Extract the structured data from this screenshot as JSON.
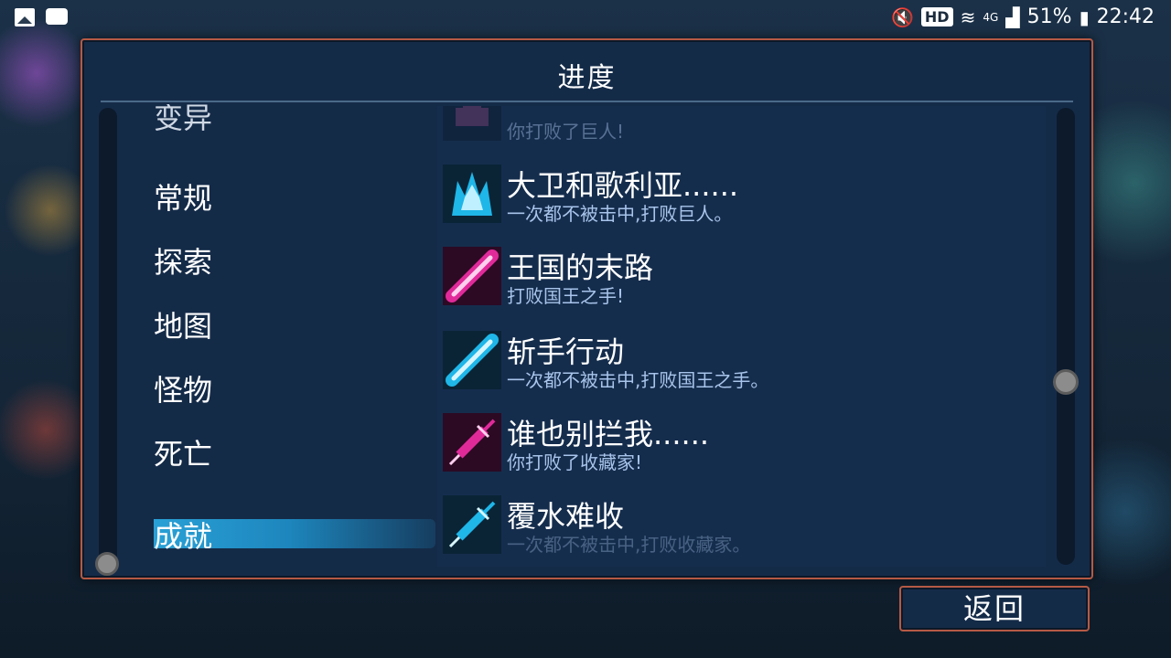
{
  "status_bar": {
    "left_icons": [
      "image-icon",
      "message-icon"
    ],
    "hd_label": "HD",
    "network": "4G",
    "battery": "51%",
    "time": "22:42"
  },
  "panel": {
    "title": "进度"
  },
  "menu": {
    "items": [
      {
        "label": "变异",
        "state": "partially-visible"
      },
      {
        "label": "常规"
      },
      {
        "label": "探索"
      },
      {
        "label": "地图"
      },
      {
        "label": "怪物"
      },
      {
        "label": "死亡"
      },
      {
        "label": "成就",
        "state": "selected"
      }
    ]
  },
  "achievements": [
    {
      "title": "",
      "desc": "你打败了巨人!",
      "icon": "giant-icon",
      "state": "partially-visible"
    },
    {
      "title": "大卫和歌利亚......",
      "desc": "一次都不被击中,打败巨人。",
      "icon": "giant-crown-icon",
      "icon_color": "#1fb6e8"
    },
    {
      "title": "王国的末路",
      "desc": "打败国王之手!",
      "icon": "blade-icon",
      "icon_color": "#e02a9a"
    },
    {
      "title": "斩手行动",
      "desc": "一次都不被击中,打败国王之手。",
      "icon": "blade-icon",
      "icon_color": "#1fb6e8"
    },
    {
      "title": "谁也别拦我......",
      "desc": "你打败了收藏家!",
      "icon": "syringe-icon",
      "icon_color": "#e02a9a"
    },
    {
      "title": "覆水难收",
      "desc": "一次都不被击中,打败收藏家。",
      "icon": "syringe-icon",
      "icon_color": "#1fb6e8"
    }
  ],
  "back_button": {
    "label": "返回"
  },
  "colors": {
    "panel_border": "#b55a45",
    "accent_blue": "#2aa3d8",
    "desc_text": "#a8c4ea"
  }
}
